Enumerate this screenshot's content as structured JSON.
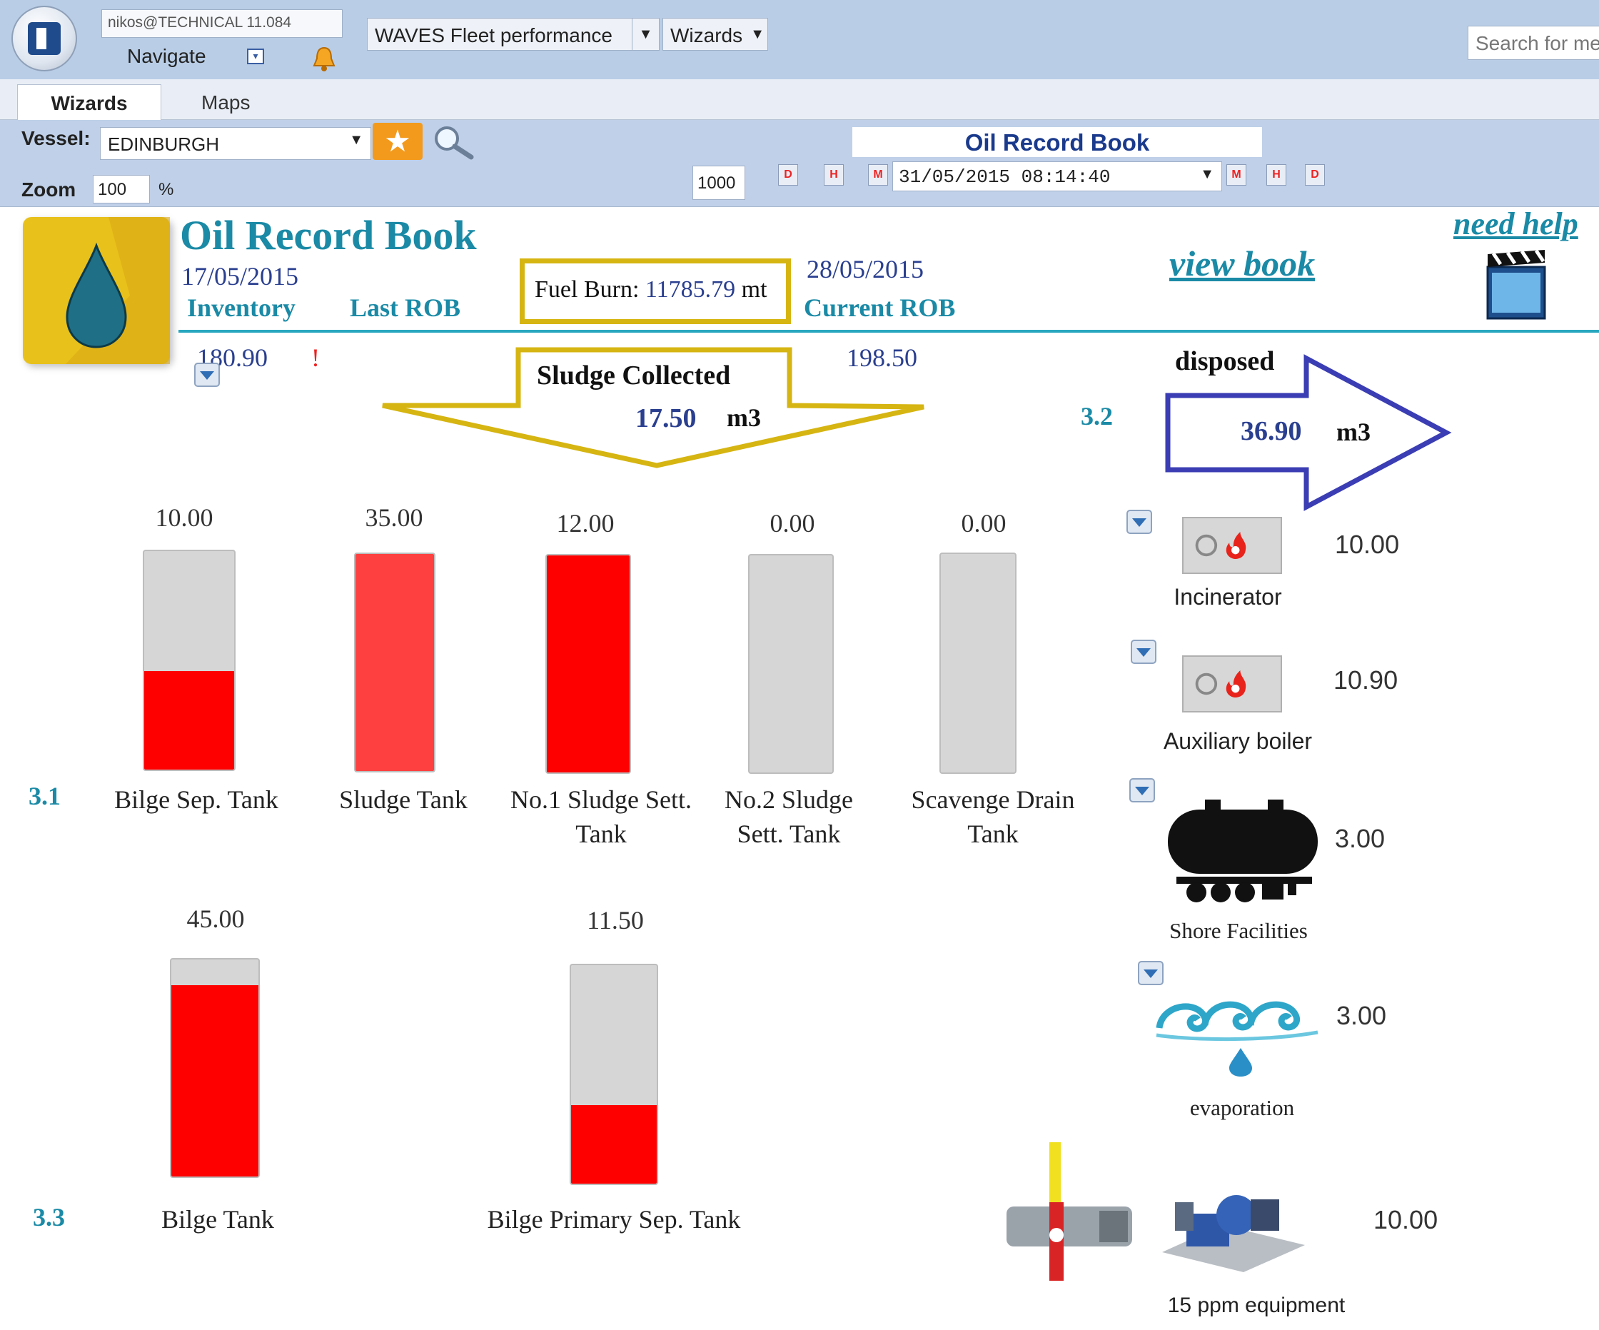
{
  "header": {
    "user": "nikos@TECHNICAL 11.084",
    "navigate_label": "Navigate",
    "module": "WAVES Fleet performance",
    "wizards_menu": "Wizards",
    "search_placeholder": "Search for me"
  },
  "tabs": [
    {
      "label": "Wizards",
      "active": true
    },
    {
      "label": "Maps",
      "active": false
    }
  ],
  "controls": {
    "vessel_label": "Vessel:",
    "vessel": "EDINBURGH",
    "zoom_label": "Zoom",
    "zoom_value": "100",
    "zoom_unit": "%",
    "small_input_value": "1000",
    "book_title": "Oil Record Book",
    "datetime": "31/05/2015 08:14:40",
    "step_buttons_back": [
      "D",
      "H",
      "M"
    ],
    "step_buttons_forward": [
      "M",
      "H",
      "D"
    ]
  },
  "summary": {
    "title": "Oil Record Book",
    "inventory_date": "17/05/2015",
    "inventory_label": "Inventory",
    "last_rob_label": "Last ROB",
    "fuel_burn_label": "Fuel Burn:",
    "fuel_burn_value": "11785.79",
    "fuel_burn_unit": "mt",
    "current_date": "28/05/2015",
    "current_rob_label": "Current ROB",
    "view_book_link": "view book",
    "need_help_link": "need help",
    "last_rob_value": "180.90",
    "last_rob_flag": "!",
    "current_rob_value": "198.50"
  },
  "sludge": {
    "label": "Sludge Collected",
    "value": "17.50",
    "unit": "m3"
  },
  "disposed": {
    "label": "disposed",
    "value": "36.90",
    "unit": "m3",
    "section": "3.2"
  },
  "sections": {
    "s31": "3.1",
    "s33": "3.3"
  },
  "tanks": [
    {
      "name": "Bilge Sep. Tank",
      "value": "10.00",
      "fill": 0.45,
      "color": "#ff0000"
    },
    {
      "name": "Sludge Tank",
      "value": "35.00",
      "fill": 1.0,
      "color": "#ff4040"
    },
    {
      "name": "No.1 Sludge Sett. Tank",
      "value": "12.00",
      "fill": 1.0,
      "color": "#ff0000"
    },
    {
      "name": "No.2 Sludge Sett. Tank",
      "value": "0.00",
      "fill": 0.0,
      "color": "#ff0000"
    },
    {
      "name": "Scavenge Drain Tank",
      "value": "0.00",
      "fill": 0.0,
      "color": "#ff0000"
    },
    {
      "name": "Bilge Tank",
      "value": "45.00",
      "fill": 0.88,
      "color": "#ff0000"
    },
    {
      "name": "Bilge Primary Sep. Tank",
      "value": "11.50",
      "fill": 0.36,
      "color": "#ff0000"
    }
  ],
  "disposal": [
    {
      "name": "Incinerator",
      "value": "10.00",
      "icon": "incinerator-icon"
    },
    {
      "name": "Auxiliary boiler",
      "value": "10.90",
      "icon": "boiler-icon"
    },
    {
      "name": "Shore Facilities",
      "value": "3.00",
      "icon": "tank-truck-icon"
    },
    {
      "name": "evaporation",
      "value": "3.00",
      "icon": "evaporation-icon"
    },
    {
      "name": "15 ppm equipment",
      "value": "10.00",
      "icon": "separator-equipment-icon"
    }
  ]
}
